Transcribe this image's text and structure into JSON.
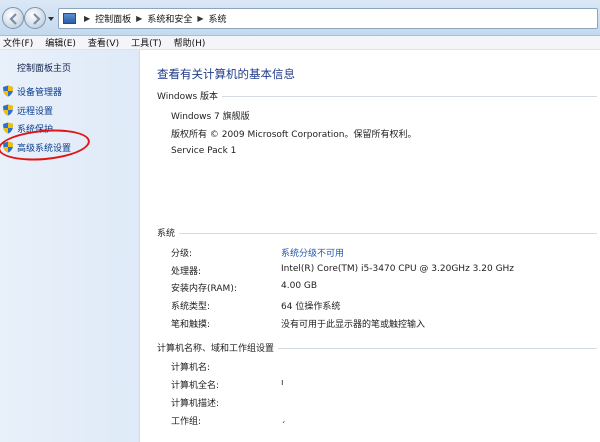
{
  "address_bar": {
    "crumbs": [
      "控制面板",
      "系统和安全",
      "系统"
    ]
  },
  "menu": [
    "文件(F)",
    "编辑(E)",
    "查看(V)",
    "工具(T)",
    "帮助(H)"
  ],
  "sidebar": {
    "home": "控制面板主页",
    "items": [
      {
        "label": "设备管理器",
        "icon": "shield-icon"
      },
      {
        "label": "远程设置",
        "icon": "shield-icon"
      },
      {
        "label": "系统保护",
        "icon": "shield-icon"
      },
      {
        "label": "高级系统设置",
        "icon": "shield-icon"
      }
    ],
    "highlight_color": "#e01616"
  },
  "main": {
    "title": "查看有关计算机的基本信息",
    "windows_edition": {
      "header": "Windows 版本",
      "edition": "Windows 7 旗舰版",
      "copyright": "版权所有 © 2009 Microsoft Corporation。保留所有权利。",
      "service_pack": "Service Pack 1"
    },
    "system": {
      "header": "系统",
      "rows": [
        {
          "label": "分级:",
          "value": "系统分级不可用",
          "is_link": true
        },
        {
          "label": "处理器:",
          "value": "Intel(R) Core(TM) i5-3470 CPU @ 3.20GHz   3.20 GHz"
        },
        {
          "label": "安装内存(RAM):",
          "value": "4.00 GB"
        },
        {
          "label": "系统类型:",
          "value": "64 位操作系统"
        },
        {
          "label": "笔和触摸:",
          "value": "没有可用于此显示器的笔或触控输入"
        }
      ]
    },
    "computer": {
      "header": "计算机名称、域和工作组设置",
      "rows": [
        {
          "label": "计算机名:",
          "value": ""
        },
        {
          "label": "计算机全名:",
          "value": "ı"
        },
        {
          "label": "计算机描述:",
          "value": ""
        },
        {
          "label": "工作组:",
          "value": "ˏ"
        }
      ]
    }
  }
}
